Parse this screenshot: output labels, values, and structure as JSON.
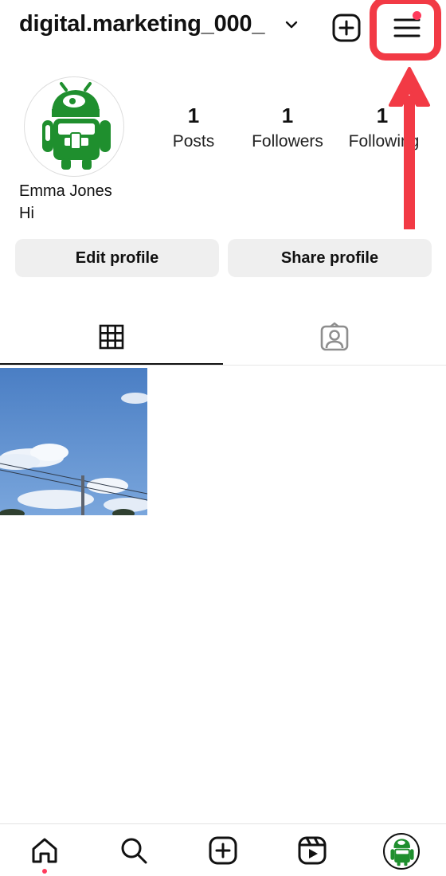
{
  "header": {
    "username": "digital.marketing_000_",
    "chevron_icon": "chevron-down-icon",
    "create_icon": "plus-square-icon",
    "menu_icon": "hamburger-menu-icon",
    "notification_dot_color": "#ff3b5c",
    "highlight_color": "#f23a45"
  },
  "profile": {
    "avatar_icon": "android-robot-avatar",
    "stats": [
      {
        "value": "1",
        "label": "Posts"
      },
      {
        "value": "1",
        "label": "Followers"
      },
      {
        "value": "1",
        "label": "Following"
      }
    ],
    "name": "Emma Jones",
    "bio": "Hi"
  },
  "actions": {
    "edit_label": "Edit profile",
    "share_label": "Share profile"
  },
  "tabs": [
    {
      "icon": "grid-icon",
      "active": true
    },
    {
      "icon": "tagged-person-icon",
      "active": false
    }
  ],
  "posts": [
    {
      "type": "image",
      "subject": "sky-clouds-power-line"
    }
  ],
  "bottom_nav": [
    {
      "icon": "home-icon",
      "active": true
    },
    {
      "icon": "search-icon"
    },
    {
      "icon": "create-icon"
    },
    {
      "icon": "reels-icon"
    },
    {
      "icon": "profile-avatar-icon"
    }
  ]
}
